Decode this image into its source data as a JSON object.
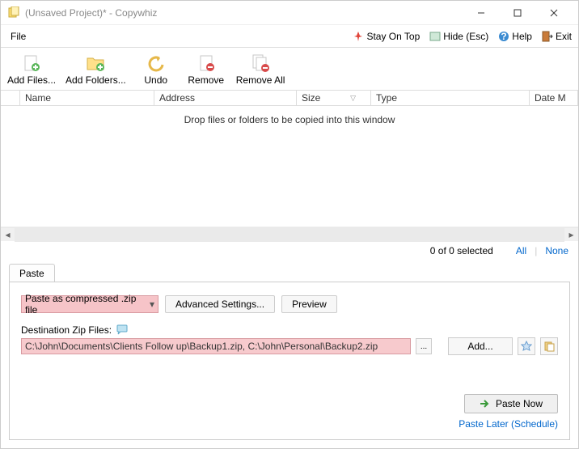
{
  "window": {
    "title": "(Unsaved Project)* - Copywhiz"
  },
  "menubar": {
    "file": "File",
    "stay_on_top": "Stay On Top",
    "hide": "Hide (Esc)",
    "help": "Help",
    "exit": "Exit"
  },
  "toolbar": {
    "add_files": "Add Files...",
    "add_folders": "Add Folders...",
    "undo": "Undo",
    "remove": "Remove",
    "remove_all": "Remove All"
  },
  "grid": {
    "columns": {
      "name": "Name",
      "address": "Address",
      "size": "Size",
      "type": "Type",
      "date": "Date M"
    },
    "empty_hint": "Drop files or folders to be copied into this window"
  },
  "status": {
    "selection": "0 of 0 selected",
    "all": "All",
    "none": "None"
  },
  "tabs": {
    "paste": "Paste"
  },
  "paste": {
    "mode": "Paste as compressed .zip file",
    "advanced": "Advanced Settings...",
    "preview": "Preview",
    "dest_label": "Destination Zip Files:",
    "dest_path": "C:\\John\\Documents\\Clients Follow up\\Backup1.zip, C:\\John\\Personal\\Backup2.zip",
    "browse": "...",
    "add": "Add...",
    "paste_now": "Paste Now",
    "schedule": "Paste Later (Schedule)"
  }
}
